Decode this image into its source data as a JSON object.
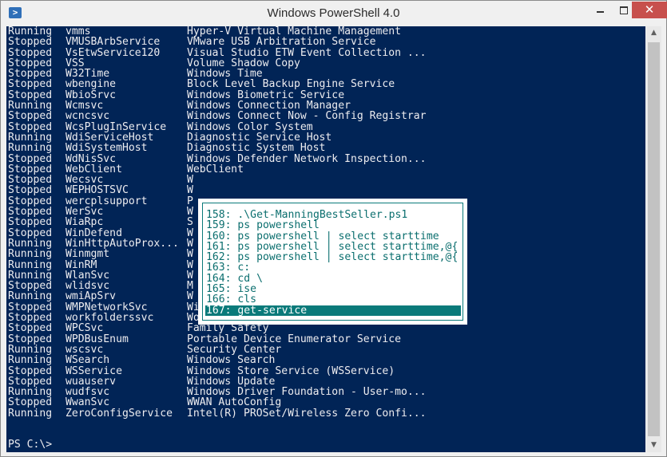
{
  "window": {
    "title": "Windows PowerShell 4.0",
    "icon_name": "powershell-icon",
    "controls": {
      "minimize": "minimize-icon",
      "maximize": "maximize-icon",
      "close": "✕"
    }
  },
  "colors": {
    "console_bg": "#012456",
    "console_fg": "#eeedf0",
    "popup_fg": "#0a6e6e",
    "close_bg": "#c7504d"
  },
  "services": [
    {
      "status": "Running",
      "name": "vmms",
      "display": "Hyper-V Virtual Machine Management"
    },
    {
      "status": "Stopped",
      "name": "VMUSBArbService",
      "display": "VMware USB Arbitration Service"
    },
    {
      "status": "Stopped",
      "name": "VsEtwService120",
      "display": "Visual Studio ETW Event Collection ..."
    },
    {
      "status": "Stopped",
      "name": "VSS",
      "display": "Volume Shadow Copy"
    },
    {
      "status": "Stopped",
      "name": "W32Time",
      "display": "Windows Time"
    },
    {
      "status": "Stopped",
      "name": "wbengine",
      "display": "Block Level Backup Engine Service"
    },
    {
      "status": "Stopped",
      "name": "WbioSrvc",
      "display": "Windows Biometric Service"
    },
    {
      "status": "Running",
      "name": "Wcmsvc",
      "display": "Windows Connection Manager"
    },
    {
      "status": "Stopped",
      "name": "wcncsvc",
      "display": "Windows Connect Now - Config Registrar"
    },
    {
      "status": "Stopped",
      "name": "WcsPlugInService",
      "display": "Windows Color System"
    },
    {
      "status": "Running",
      "name": "WdiServiceHost",
      "display": "Diagnostic Service Host"
    },
    {
      "status": "Running",
      "name": "WdiSystemHost",
      "display": "Diagnostic System Host"
    },
    {
      "status": "Stopped",
      "name": "WdNisSvc",
      "display": "Windows Defender Network Inspection..."
    },
    {
      "status": "Stopped",
      "name": "WebClient",
      "display": "WebClient"
    },
    {
      "status": "Stopped",
      "name": "Wecsvc",
      "display": "W"
    },
    {
      "status": "Stopped",
      "name": "WEPHOSTSVC",
      "display": "W"
    },
    {
      "status": "Stopped",
      "name": "wercplsupport",
      "display": "P"
    },
    {
      "status": "Stopped",
      "name": "WerSvc",
      "display": "W"
    },
    {
      "status": "Stopped",
      "name": "WiaRpc",
      "display": "S"
    },
    {
      "status": "Stopped",
      "name": "WinDefend",
      "display": "W"
    },
    {
      "status": "Running",
      "name": "WinHttpAutoProx...",
      "display": "W"
    },
    {
      "status": "Running",
      "name": "Winmgmt",
      "display": "W"
    },
    {
      "status": "Running",
      "name": "WinRM",
      "display": "W"
    },
    {
      "status": "Running",
      "name": "WlanSvc",
      "display": "W"
    },
    {
      "status": "Stopped",
      "name": "wlidsvc",
      "display": "M"
    },
    {
      "status": "Running",
      "name": "wmiApSrv",
      "display": "W"
    },
    {
      "status": "Stopped",
      "name": "WMPNetworkSvc",
      "display": "Windows Media Player Network Sharin..."
    },
    {
      "status": "Stopped",
      "name": "workfolderssvc",
      "display": "Work Folders"
    },
    {
      "status": "Stopped",
      "name": "WPCSvc",
      "display": "Family Safety"
    },
    {
      "status": "Stopped",
      "name": "WPDBusEnum",
      "display": "Portable Device Enumerator Service"
    },
    {
      "status": "Running",
      "name": "wscsvc",
      "display": "Security Center"
    },
    {
      "status": "Running",
      "name": "WSearch",
      "display": "Windows Search"
    },
    {
      "status": "Stopped",
      "name": "WSService",
      "display": "Windows Store Service (WSService)"
    },
    {
      "status": "Stopped",
      "name": "wuauserv",
      "display": "Windows Update"
    },
    {
      "status": "Running",
      "name": "wudfsvc",
      "display": "Windows Driver Foundation - User-mo..."
    },
    {
      "status": "Stopped",
      "name": "WwanSvc",
      "display": "WWAN AutoConfig"
    },
    {
      "status": "Running",
      "name": "ZeroConfigService",
      "display": "Intel(R) PROSet/Wireless Zero Confi..."
    }
  ],
  "prompt": "PS C:\\>",
  "history_popup": {
    "selected_index": 9,
    "items": [
      "158: .\\Get-ManningBestSeller.ps1",
      "159: ps powershell",
      "160: ps powershell | select starttime",
      "161: ps powershell | select starttime,@{",
      "162: ps powershell | select starttime,@{",
      "163: c:",
      "164: cd \\",
      "165: ise",
      "166: cls",
      "167: get-service"
    ]
  }
}
